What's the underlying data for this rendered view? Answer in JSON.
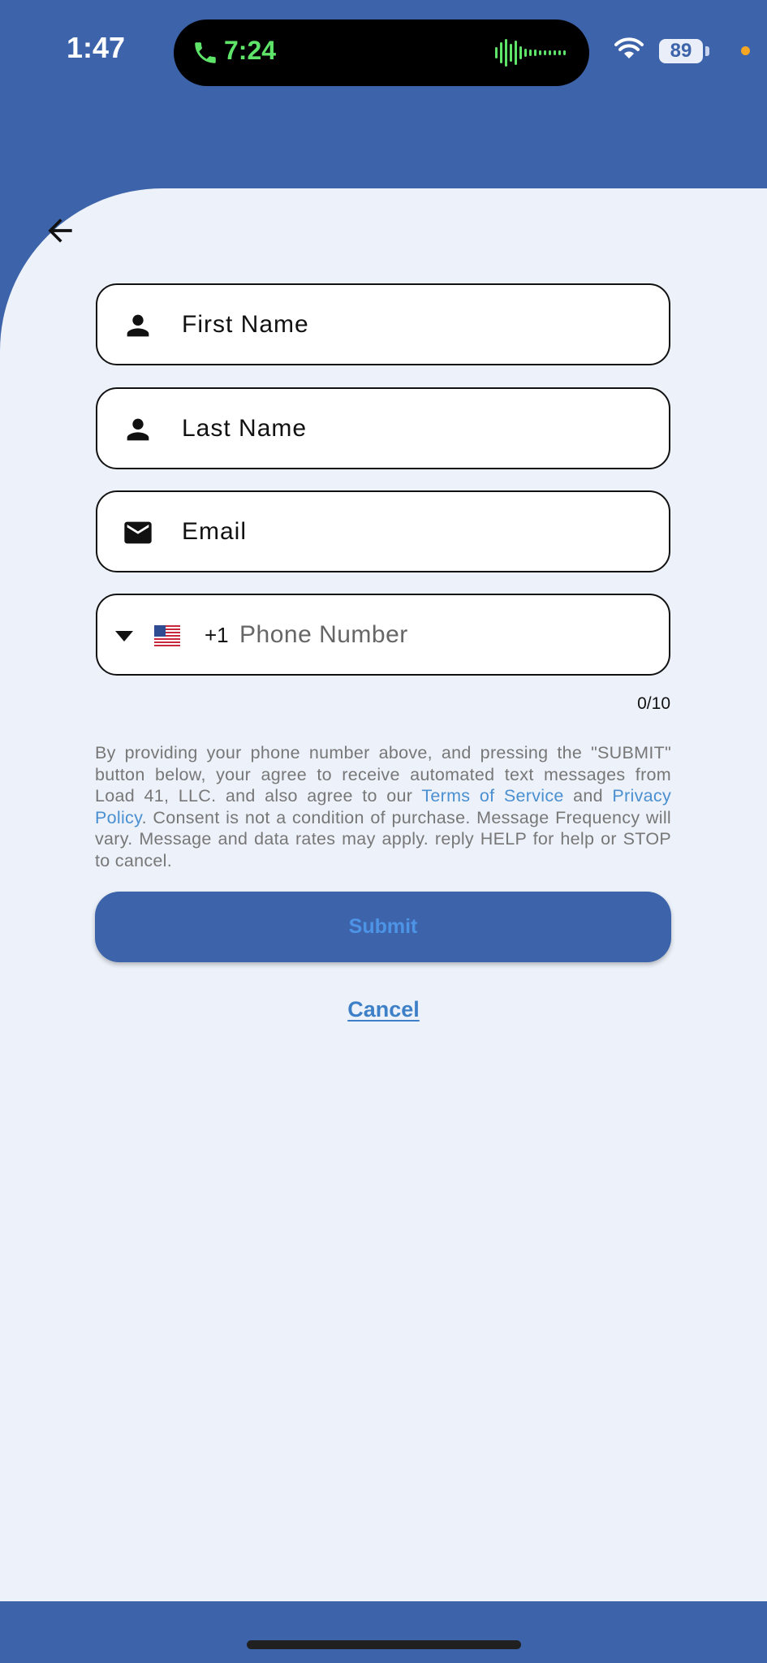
{
  "status_bar": {
    "time": "1:47",
    "call_duration": "7:24",
    "battery": "89"
  },
  "form": {
    "first_name_label": "First Name",
    "last_name_label": "Last Name",
    "email_label": "Email",
    "country_code": "+1",
    "phone_placeholder": "Phone Number",
    "phone_counter": "0/10"
  },
  "consent": {
    "part1": "By providing your phone number above, and pressing the \"SUBMIT\" button below, your agree to receive automated text messages from Load 41, LLC. and also agree to our ",
    "terms_link": "Terms of Service",
    "part2": " and ",
    "privacy_link": "Privacy Policy",
    "part3": ". Consent is not a condition of purchase. Message Frequency will vary. Message and data rates may apply. reply HELP for help or STOP to cancel."
  },
  "actions": {
    "submit_label": "Submit",
    "cancel_label": "Cancel"
  },
  "colors": {
    "brand_blue": "#3d63aa",
    "background": "#edf2fa",
    "link": "#4a8fd0"
  }
}
